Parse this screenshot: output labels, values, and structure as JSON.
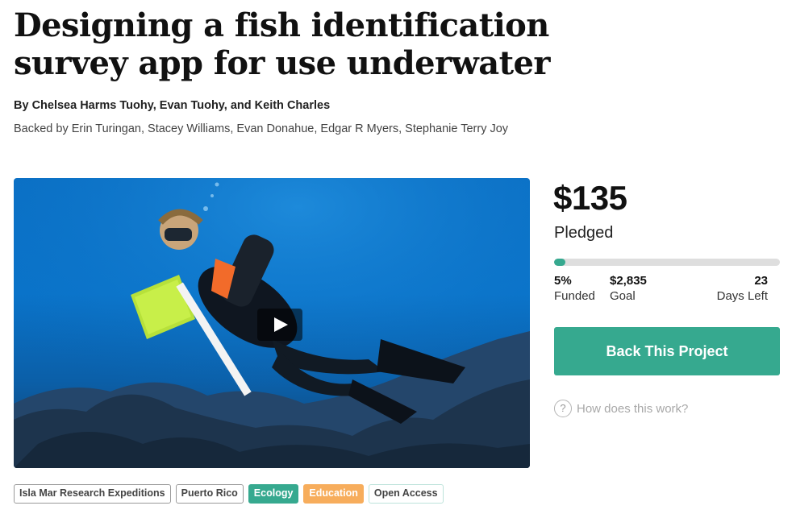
{
  "project": {
    "title": "Designing a fish identification survey app for use underwater",
    "authors": "By Chelsea Harms Tuohy, Evan Tuohy, and Keith Charles",
    "backers": "Backed by Erin Turingan, Stacey Williams, Evan Donahue, Edgar R Myers, Stephanie Terry Joy"
  },
  "funding": {
    "amount": "$135",
    "pledged_label": "Pledged",
    "progress_percent": 5,
    "funded_value": "5%",
    "funded_label": "Funded",
    "goal_value": "$2,835",
    "goal_label": "Goal",
    "days_value": "23",
    "days_label": "Days Left"
  },
  "actions": {
    "back_button": "Back This Project",
    "how_icon": "?",
    "how_link": "How does this work?"
  },
  "tags": [
    "Isla Mar Research Expeditions",
    "Puerto Rico",
    "Ecology",
    "Education",
    "Open Access"
  ],
  "colors": {
    "accent": "#36a98f",
    "education_tag": "#f7ad5c",
    "water": "#0a6fc4"
  },
  "icons": {
    "video": "play-icon",
    "help": "question-circle-icon"
  }
}
